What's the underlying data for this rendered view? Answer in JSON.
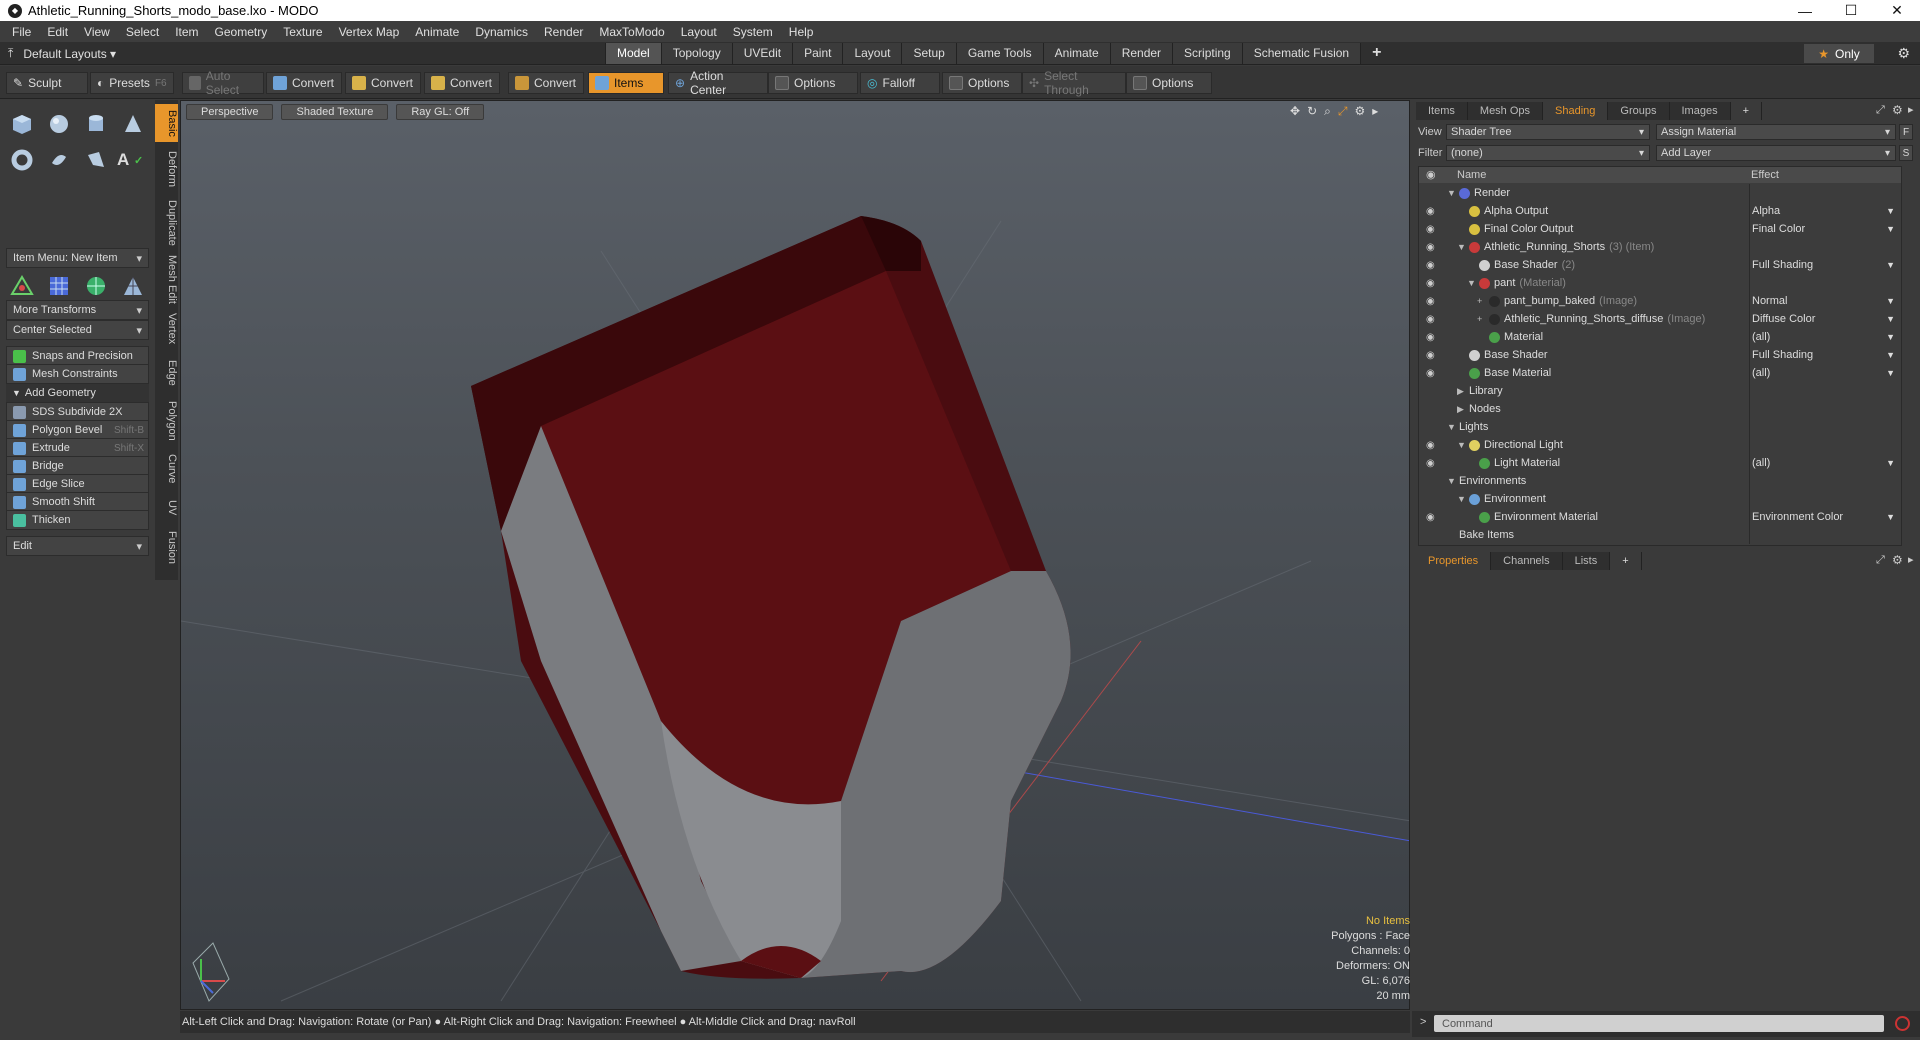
{
  "window": {
    "title": "Athletic_Running_Shorts_modo_base.lxo - MODO",
    "controls": [
      "—",
      "☐",
      "✕"
    ]
  },
  "menu": [
    "File",
    "Edit",
    "View",
    "Select",
    "Item",
    "Geometry",
    "Texture",
    "Vertex Map",
    "Animate",
    "Dynamics",
    "Render",
    "MaxToModo",
    "Layout",
    "System",
    "Help"
  ],
  "layout": {
    "default_layouts": "Default Layouts",
    "tabs": [
      "Model",
      "Topology",
      "UVEdit",
      "Paint",
      "Layout",
      "Setup",
      "Game Tools",
      "Animate",
      "Render",
      "Scripting",
      "Schematic Fusion"
    ],
    "active_tab": "Model",
    "only_label": "Only"
  },
  "toolbar": {
    "sculpt": "Sculpt",
    "presets": "Presets",
    "presets_key": "F6",
    "auto_select": "Auto Select",
    "convert1": "Convert",
    "convert2": "Convert",
    "convert3": "Convert",
    "convert4": "Convert",
    "items": "Items",
    "action_center": "Action Center",
    "options1": "Options",
    "falloff": "Falloff",
    "options2": "Options",
    "select_through": "Select Through",
    "options3": "Options"
  },
  "left": {
    "item_menu": "Item Menu: New Item",
    "more_transforms": "More Transforms",
    "center_selected": "Center Selected",
    "snaps": "Snaps and Precision",
    "mesh_constraints": "Mesh Constraints",
    "add_geometry": "Add Geometry",
    "tools": [
      {
        "label": "SDS Subdivide 2X",
        "key": ""
      },
      {
        "label": "Polygon Bevel",
        "key": "Shift-B"
      },
      {
        "label": "Extrude",
        "key": "Shift-X"
      },
      {
        "label": "Bridge",
        "key": ""
      },
      {
        "label": "Edge Slice",
        "key": ""
      },
      {
        "label": "Smooth Shift",
        "key": ""
      },
      {
        "label": "Thicken",
        "key": ""
      }
    ],
    "edit": "Edit",
    "vtabs": [
      "Basic",
      "Deform",
      "Duplicate",
      "Mesh Edit",
      "Vertex",
      "Edge",
      "Polygon",
      "Curve",
      "UV",
      "Fusion"
    ]
  },
  "viewport": {
    "buttons": [
      "Perspective",
      "Shaded Texture",
      "Ray GL: Off"
    ],
    "stats": {
      "items": "No Items",
      "polygons": "Polygons : Face",
      "channels": "Channels: 0",
      "deformers": "Deformers: ON",
      "gl": "GL: 6,076",
      "size": "20 mm"
    }
  },
  "status": "Alt-Left Click and Drag: Navigation: Rotate (or Pan) ● Alt-Right Click and Drag: Navigation: Freewheel ● Alt-Middle Click and Drag: navRoll",
  "right": {
    "tabs": [
      "Items",
      "Mesh Ops",
      "Shading",
      "Groups",
      "Images"
    ],
    "active_tab": "Shading",
    "view_label": "View",
    "view_value": "Shader Tree",
    "assign_material": "Assign Material",
    "filter_label": "Filter",
    "filter_value": "(none)",
    "add_layer": "Add Layer",
    "f_btn": "F",
    "s_btn": "S",
    "col_name": "Name",
    "col_effect": "Effect",
    "tree": [
      {
        "name": "Render",
        "tag": "",
        "effect": "",
        "eye": false,
        "indent": 0,
        "twirl": "▼",
        "color": "#5a6ad8"
      },
      {
        "name": "Alpha Output",
        "tag": "",
        "effect": "Alpha",
        "eye": true,
        "indent": 1,
        "twirl": "",
        "color": "#d8c040"
      },
      {
        "name": "Final Color Output",
        "tag": "",
        "effect": "Final Color",
        "eye": true,
        "indent": 1,
        "twirl": "",
        "color": "#d8c040"
      },
      {
        "name": "Athletic_Running_Shorts",
        "tag": "(3) (Item)",
        "effect": "",
        "eye": true,
        "indent": 1,
        "twirl": "▼",
        "color": "#c83a3a"
      },
      {
        "name": "Base Shader",
        "tag": "(2)",
        "effect": "Full Shading",
        "eye": true,
        "indent": 2,
        "twirl": "",
        "color": "#d0d0d0"
      },
      {
        "name": "pant",
        "tag": "(Material)",
        "effect": "",
        "eye": true,
        "indent": 2,
        "twirl": "▼",
        "color": "#c83a3a"
      },
      {
        "name": "pant_bump_baked",
        "tag": "(Image)",
        "effect": "Normal",
        "eye": true,
        "indent": 3,
        "twirl": "+",
        "color": "#2a2a2a"
      },
      {
        "name": "Athletic_Running_Shorts_diffuse",
        "tag": "(Image)",
        "effect": "Diffuse Color",
        "eye": true,
        "indent": 3,
        "twirl": "+",
        "color": "#2a2a2a"
      },
      {
        "name": "Material",
        "tag": "",
        "effect": "(all)",
        "eye": true,
        "indent": 3,
        "twirl": "",
        "color": "#4aa04a"
      },
      {
        "name": "Base Shader",
        "tag": "",
        "effect": "Full Shading",
        "eye": true,
        "indent": 1,
        "twirl": "",
        "color": "#d0d0d0"
      },
      {
        "name": "Base Material",
        "tag": "",
        "effect": "(all)",
        "eye": true,
        "indent": 1,
        "twirl": "",
        "color": "#4aa04a"
      },
      {
        "name": "Library",
        "tag": "",
        "effect": "",
        "eye": false,
        "indent": 1,
        "twirl": "▶",
        "color": ""
      },
      {
        "name": "Nodes",
        "tag": "",
        "effect": "",
        "eye": false,
        "indent": 1,
        "twirl": "▶",
        "color": ""
      },
      {
        "name": "Lights",
        "tag": "",
        "effect": "",
        "eye": false,
        "indent": 0,
        "twirl": "▼",
        "color": ""
      },
      {
        "name": "Directional Light",
        "tag": "",
        "effect": "",
        "eye": true,
        "indent": 1,
        "twirl": "▼",
        "color": "#e0d060"
      },
      {
        "name": "Light Material",
        "tag": "",
        "effect": "(all)",
        "eye": true,
        "indent": 2,
        "twirl": "",
        "color": "#4aa04a"
      },
      {
        "name": "Environments",
        "tag": "",
        "effect": "",
        "eye": false,
        "indent": 0,
        "twirl": "▼",
        "color": ""
      },
      {
        "name": "Environment",
        "tag": "",
        "effect": "",
        "eye": false,
        "indent": 1,
        "twirl": "▼",
        "color": "#6aa0d8"
      },
      {
        "name": "Environment Material",
        "tag": "",
        "effect": "Environment Color",
        "eye": true,
        "indent": 2,
        "twirl": "",
        "color": "#4aa04a"
      },
      {
        "name": "Bake Items",
        "tag": "",
        "effect": "",
        "eye": false,
        "indent": 0,
        "twirl": "",
        "color": ""
      }
    ],
    "lower_tabs": [
      "Properties",
      "Channels",
      "Lists"
    ],
    "lower_active": "Properties",
    "command_placeholder": "Command"
  },
  "colors": {
    "accent": "#e8962b",
    "shorts_main": "#5a0f12",
    "shorts_trim": "#7d7f82"
  }
}
